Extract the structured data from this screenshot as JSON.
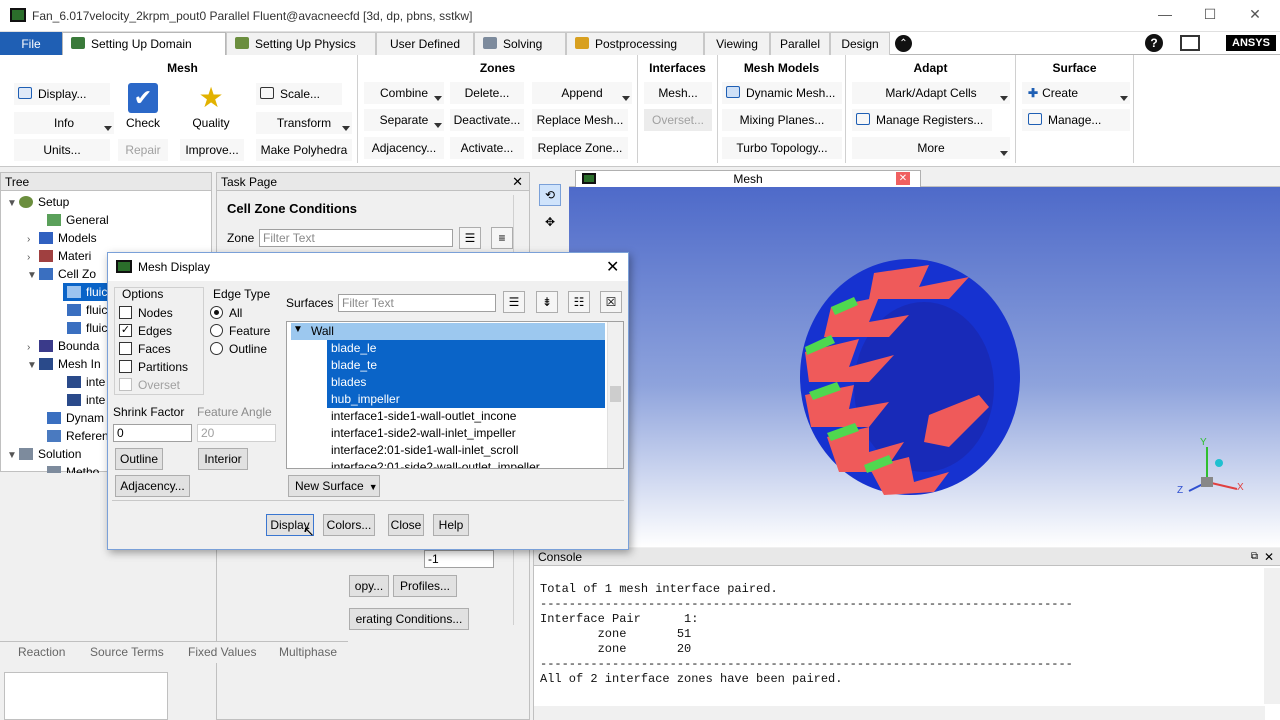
{
  "window": {
    "title": "Fan_6.017velocity_2krpm_pout0 Parallel Fluent@avacneecfd  [3d, dp, pbns, sstkw]",
    "controls": [
      "—",
      "☐",
      "✕"
    ]
  },
  "ribbon_tabs": [
    {
      "label": "File"
    },
    {
      "label": "Setting Up Domain"
    },
    {
      "label": "Setting Up Physics"
    },
    {
      "label": "User Defined"
    },
    {
      "label": "Solving"
    },
    {
      "label": "Postprocessing"
    },
    {
      "label": "Viewing"
    },
    {
      "label": "Parallel"
    },
    {
      "label": "Design"
    }
  ],
  "brand": "ANSYS",
  "ribbon": {
    "mesh": {
      "title": "Mesh",
      "display": "Display...",
      "info": "Info",
      "units": "Units...",
      "check": "Check",
      "repair": "Repair",
      "quality": "Quality",
      "improve": "Improve...",
      "scale": "Scale...",
      "transform": "Transform",
      "make_polyhedra": "Make Polyhedra"
    },
    "zones": {
      "title": "Zones",
      "combine": "Combine",
      "separate": "Separate",
      "adjacency": "Adjacency...",
      "delete": "Delete...",
      "deactivate": "Deactivate...",
      "activate": "Activate...",
      "append": "Append",
      "replace_mesh": "Replace Mesh...",
      "replace_zone": "Replace Zone..."
    },
    "interfaces": {
      "title": "Interfaces",
      "mesh": "Mesh...",
      "overset": "Overset..."
    },
    "mesh_models": {
      "title": "Mesh Models",
      "dynamic_mesh": "Dynamic Mesh...",
      "mixing_planes": "Mixing Planes...",
      "turbo_topology": "Turbo Topology..."
    },
    "adapt": {
      "title": "Adapt",
      "mark_adapt": "Mark/Adapt Cells",
      "manage_registers": "Manage Registers...",
      "more": "More"
    },
    "surface": {
      "title": "Surface",
      "create": "Create",
      "manage": "Manage..."
    }
  },
  "tree": {
    "header": "Tree",
    "items": [
      {
        "label": "Setup"
      },
      {
        "label": "General"
      },
      {
        "label": "Models"
      },
      {
        "label": "Materi"
      },
      {
        "label": "Cell Zo"
      },
      {
        "label": "fluic"
      },
      {
        "label": "fluic"
      },
      {
        "label": "fluic"
      },
      {
        "label": "Bounda"
      },
      {
        "label": "Mesh In"
      },
      {
        "label": "inte"
      },
      {
        "label": "inte"
      },
      {
        "label": "Dynam"
      },
      {
        "label": "Referen"
      },
      {
        "label": "Solution"
      },
      {
        "label": "Metho"
      }
    ]
  },
  "task_page": {
    "header": "Task Page",
    "title": "Cell Zone Conditions",
    "zone_label": "Zone",
    "zone_placeholder": "Filter Text",
    "id_value": "-1",
    "copy_btn": "opy...",
    "profiles_btn": "Profiles...",
    "operating_btn": "erating Conditions...",
    "bottom_tabs": [
      "Reaction",
      "Source Terms",
      "Fixed Values",
      "Multiphase"
    ]
  },
  "graphics": {
    "tab_label": "Mesh",
    "axis_x": "X",
    "axis_y": "Y",
    "axis_z": "Z"
  },
  "dialog": {
    "title": "Mesh Display",
    "options_label": "Options",
    "options": [
      {
        "label": "Nodes",
        "checked": false
      },
      {
        "label": "Edges",
        "checked": true
      },
      {
        "label": "Faces",
        "checked": false
      },
      {
        "label": "Partitions",
        "checked": false
      },
      {
        "label": "Overset",
        "checked": false
      }
    ],
    "edge_type_label": "Edge Type",
    "edge_types": [
      {
        "label": "All",
        "selected": true
      },
      {
        "label": "Feature",
        "selected": false
      },
      {
        "label": "Outline",
        "selected": false
      }
    ],
    "shrink_factor_label": "Shrink Factor",
    "shrink_factor_value": "0",
    "feature_angle_label": "Feature Angle",
    "feature_angle_value": "20",
    "outline_btn": "Outline",
    "interior_btn": "Interior",
    "adjacency_btn": "Adjacency...",
    "surfaces_label": "Surfaces",
    "surfaces_placeholder": "Filter Text",
    "surface_group": "Wall",
    "surfaces": [
      {
        "label": "blade_le",
        "selected": true
      },
      {
        "label": "blade_te",
        "selected": true
      },
      {
        "label": "blades",
        "selected": true
      },
      {
        "label": "hub_impeller",
        "selected": true
      },
      {
        "label": "interface1-side1-wall-outlet_incone",
        "selected": false
      },
      {
        "label": "interface1-side2-wall-inlet_impeller",
        "selected": false
      },
      {
        "label": "interface2:01-side1-wall-inlet_scroll",
        "selected": false
      },
      {
        "label": "interface2:01-side2-wall-outlet_impeller",
        "selected": false
      }
    ],
    "new_surface_btn": "New Surface",
    "display_btn": "Display",
    "colors_btn": "Colors...",
    "close_btn": "Close",
    "help_btn": "Help"
  },
  "console": {
    "header": "Console",
    "lines": [
      "Total of 1 mesh interface paired.",
      "--------------------------------------------------------------------------",
      "Interface Pair      1:",
      "        zone       51",
      "        zone       20",
      "--------------------------------------------------------------------------",
      "All of 2 interface zones have been paired."
    ]
  },
  "colors": {
    "accent": "#1f5fb4",
    "selection": "#0a64c8",
    "mesh_blue": "#1632d0",
    "blade_red": "#ef5a5a",
    "blade_green": "#4fd84f"
  }
}
